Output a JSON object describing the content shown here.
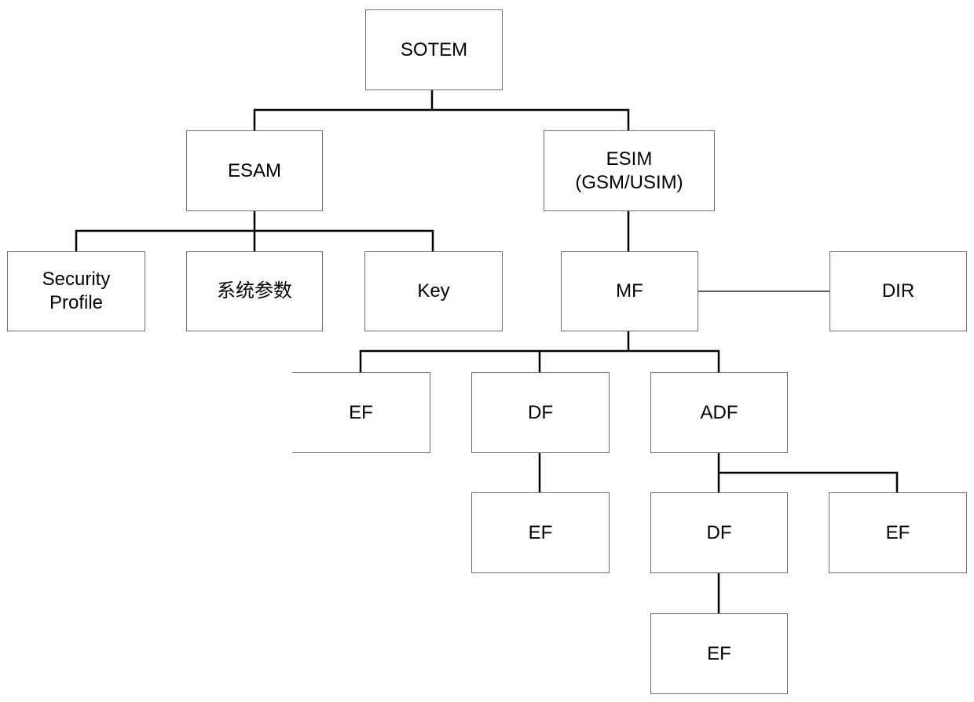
{
  "diagram": {
    "type": "tree",
    "nodes": {
      "sotem": "SOTEM",
      "esam": "ESAM",
      "esim": "ESIM\n(GSM/USIM)",
      "security_profile": "Security\nProfile",
      "system_params": "系统参数",
      "key": "Key",
      "mf": "MF",
      "dir": "DIR",
      "ef1": "EF",
      "df1": "DF",
      "adf": "ADF",
      "ef2": "EF",
      "df2": "DF",
      "ef3": "EF",
      "ef4": "EF"
    },
    "edges": [
      [
        "sotem",
        "esam"
      ],
      [
        "sotem",
        "esim"
      ],
      [
        "esam",
        "security_profile"
      ],
      [
        "esam",
        "system_params"
      ],
      [
        "esam",
        "key"
      ],
      [
        "esim",
        "mf"
      ],
      [
        "mf",
        "dir"
      ],
      [
        "mf",
        "ef1"
      ],
      [
        "mf",
        "df1"
      ],
      [
        "mf",
        "adf"
      ],
      [
        "df1",
        "ef2"
      ],
      [
        "adf",
        "df2"
      ],
      [
        "adf",
        "ef3"
      ],
      [
        "df2",
        "ef4"
      ]
    ]
  }
}
